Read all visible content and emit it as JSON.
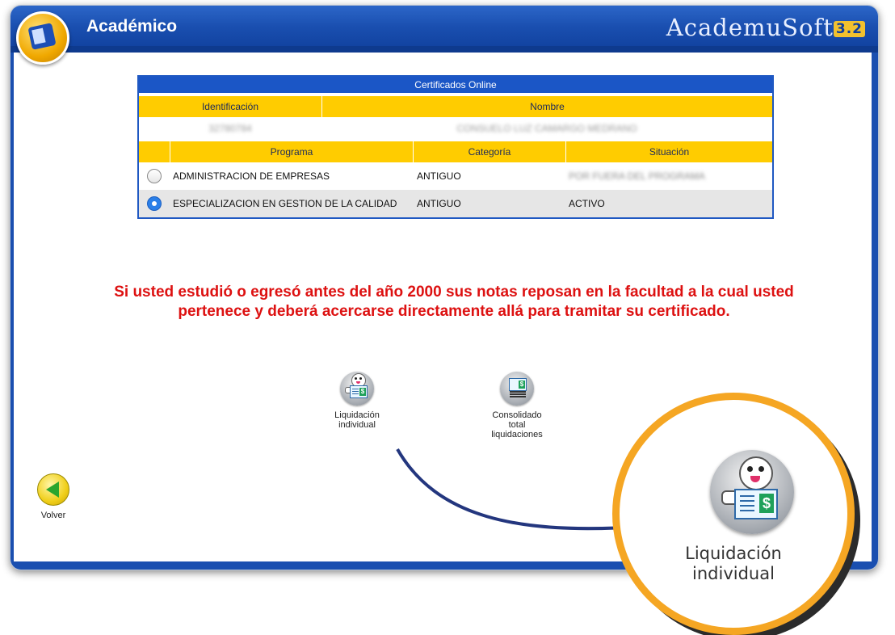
{
  "header": {
    "title": "Académico",
    "brand": "AcademuSoft",
    "brand_version": "3.2"
  },
  "certificates": {
    "title": "Certificados Online",
    "id_header": "Identificación",
    "name_header": "Nombre",
    "id_value": "32780784",
    "name_value": "CONSUELO LUZ CAMARGO MEDRANO",
    "program_headers": [
      "Programa",
      "Categoría",
      "Situación"
    ],
    "programs": [
      {
        "name": "ADMINISTRACION DE EMPRESAS",
        "category": "ANTIGUO",
        "status": "POR FUERA DEL PROGRAMA",
        "selected": false
      },
      {
        "name": "ESPECIALIZACION EN GESTION DE LA CALIDAD",
        "category": "ANTIGUO",
        "status": "ACTIVO",
        "selected": true
      }
    ]
  },
  "notice": "Si usted estudió o egresó antes del año 2000 sus notas reposan en la facultad a la cual usted pertenece y deberá acercarse directamente allá para tramitar su certificado.",
  "actions": {
    "individual": "Liquidación individual",
    "consolidated": "Consolidado total liquidaciones"
  },
  "back_label": "Volver",
  "zoom": {
    "label": "Liquidación individual"
  },
  "colors": {
    "header_blue": "#1a4fb0",
    "table_header": "#ffcc00",
    "notice_red": "#dd1111",
    "callout_orange": "#f5a623",
    "connector": "#23367e"
  }
}
